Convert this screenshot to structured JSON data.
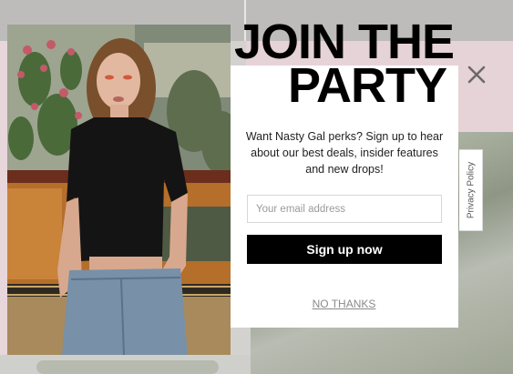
{
  "modal": {
    "headline_line1": "JOIN THE",
    "headline_line2": "PARTY",
    "description": "Want Nasty Gal perks? Sign up to hear about our best deals, insider features and new drops!",
    "email_placeholder": "Your email address",
    "email_value": "",
    "signup_label": "Sign up now",
    "no_thanks_label": "NO THANKS",
    "close_icon": "close-icon",
    "privacy_tab_label": "Privacy Policy"
  },
  "colors": {
    "panel": "#ffffff",
    "button": "#000000",
    "button_text": "#ffffff",
    "backdrop_pink": "#e6d3d7"
  }
}
